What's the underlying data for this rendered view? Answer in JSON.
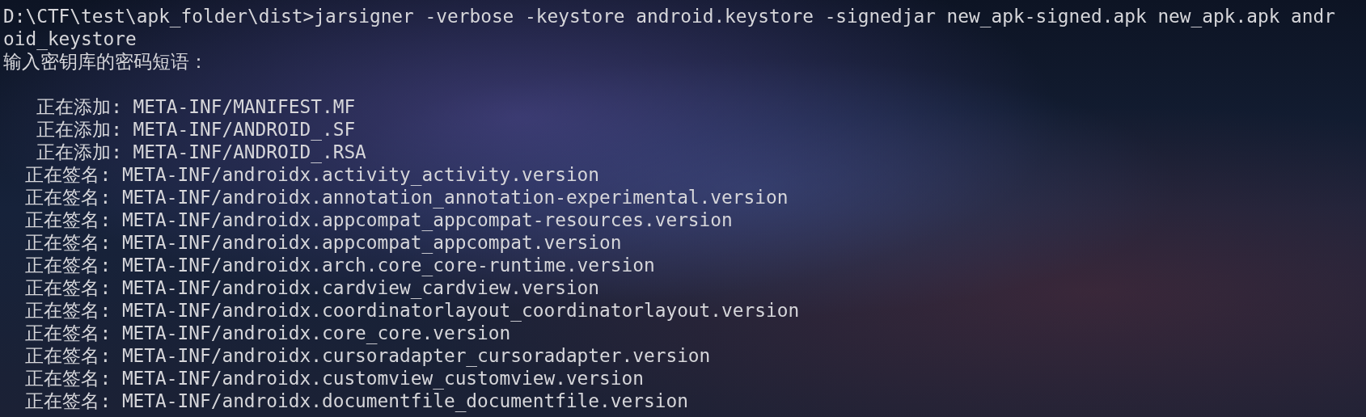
{
  "terminal": {
    "command_lines": [
      "D:\\CTF\\test\\apk_folder\\dist>jarsigner -verbose -keystore android.keystore -signedjar new_apk-signed.apk new_apk.apk andr",
      "oid_keystore"
    ],
    "prompt": "输入密钥库的密码短语：",
    "output": [
      {
        "kind": "adding",
        "text": "正在添加: META-INF/MANIFEST.MF"
      },
      {
        "kind": "adding",
        "text": "正在添加: META-INF/ANDROID_.SF"
      },
      {
        "kind": "adding",
        "text": "正在添加: META-INF/ANDROID_.RSA"
      },
      {
        "kind": "signing",
        "text": "正在签名: META-INF/androidx.activity_activity.version"
      },
      {
        "kind": "signing",
        "text": "正在签名: META-INF/androidx.annotation_annotation-experimental.version"
      },
      {
        "kind": "signing",
        "text": "正在签名: META-INF/androidx.appcompat_appcompat-resources.version"
      },
      {
        "kind": "signing",
        "text": "正在签名: META-INF/androidx.appcompat_appcompat.version"
      },
      {
        "kind": "signing",
        "text": "正在签名: META-INF/androidx.arch.core_core-runtime.version"
      },
      {
        "kind": "signing",
        "text": "正在签名: META-INF/androidx.cardview_cardview.version"
      },
      {
        "kind": "signing",
        "text": "正在签名: META-INF/androidx.coordinatorlayout_coordinatorlayout.version"
      },
      {
        "kind": "signing",
        "text": "正在签名: META-INF/androidx.core_core.version"
      },
      {
        "kind": "signing",
        "text": "正在签名: META-INF/androidx.cursoradapter_cursoradapter.version"
      },
      {
        "kind": "signing",
        "text": "正在签名: META-INF/androidx.customview_customview.version"
      },
      {
        "kind": "signing",
        "text": "正在签名: META-INF/androidx.documentfile_documentfile.version"
      }
    ]
  }
}
